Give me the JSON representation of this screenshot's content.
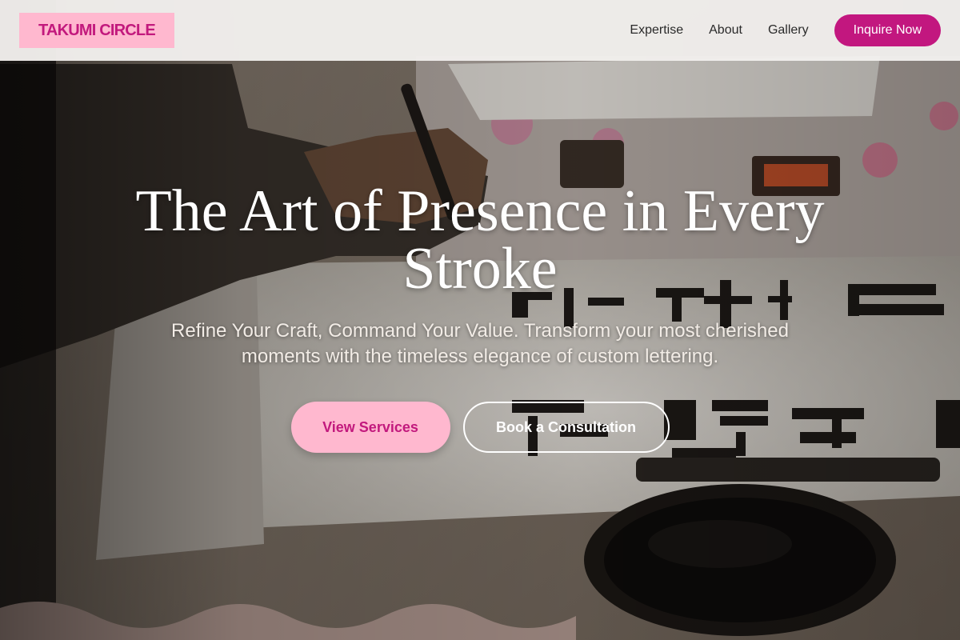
{
  "header": {
    "logo": "TAKUMI CIRCLE",
    "nav": [
      {
        "label": "Expertise"
      },
      {
        "label": "About"
      },
      {
        "label": "Gallery"
      }
    ],
    "cta_label": "Inquire Now"
  },
  "hero": {
    "title": "The Art of Presence in Every Stroke",
    "subtitle": "Refine Your Craft, Command Your Value. Transform your most cherished moments with the timeless elegance of custom lettering.",
    "primary_button": "View Services",
    "secondary_button": "Book a Consultation",
    "background_image": "calligraphy-brush-on-paper-photo"
  },
  "colors": {
    "brand": "#c2177f",
    "accent_pink": "#ffb8cf",
    "header_bg": "#f2f0ee",
    "hero_text": "#ffffff"
  }
}
